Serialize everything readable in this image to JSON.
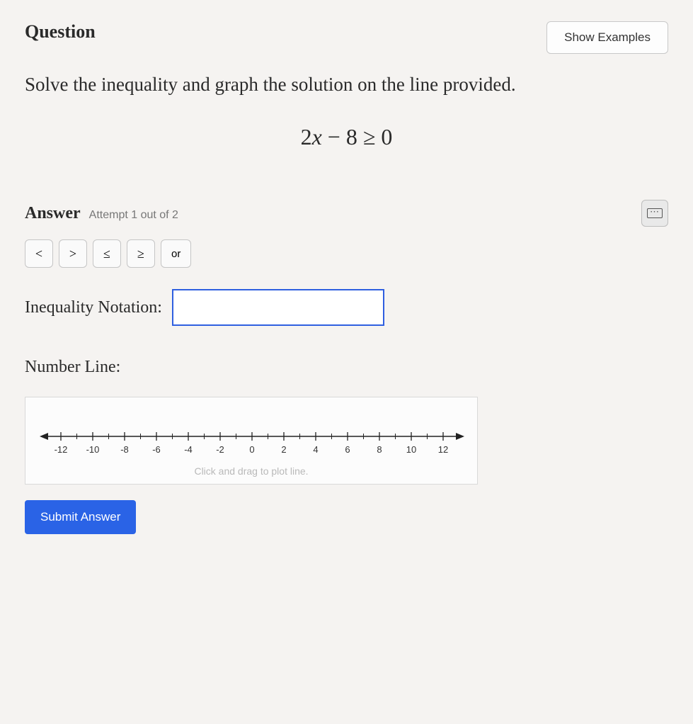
{
  "header": {
    "title": "Question",
    "show_examples": "Show Examples"
  },
  "prompt": "Solve the inequality and graph the solution on the line provided.",
  "equation": {
    "lhs_coef": "2",
    "lhs_var": "x",
    "op_minus": " − ",
    "lhs_const": "8",
    "rel": " ≥ ",
    "rhs": "0"
  },
  "answer": {
    "label": "Answer",
    "attempt": "Attempt 1 out of 2",
    "ops": {
      "lt": "<",
      "gt": ">",
      "le": "≤",
      "ge": "≥",
      "or": "or"
    },
    "notation_label": "Inequality Notation:",
    "notation_value": ""
  },
  "numberline": {
    "label": "Number Line:",
    "ticks": [
      "-12",
      "-10",
      "-8",
      "-6",
      "-4",
      "-2",
      "0",
      "2",
      "4",
      "6",
      "8",
      "10",
      "12"
    ],
    "hint": "Click and drag to plot line."
  },
  "submit": "Submit Answer"
}
